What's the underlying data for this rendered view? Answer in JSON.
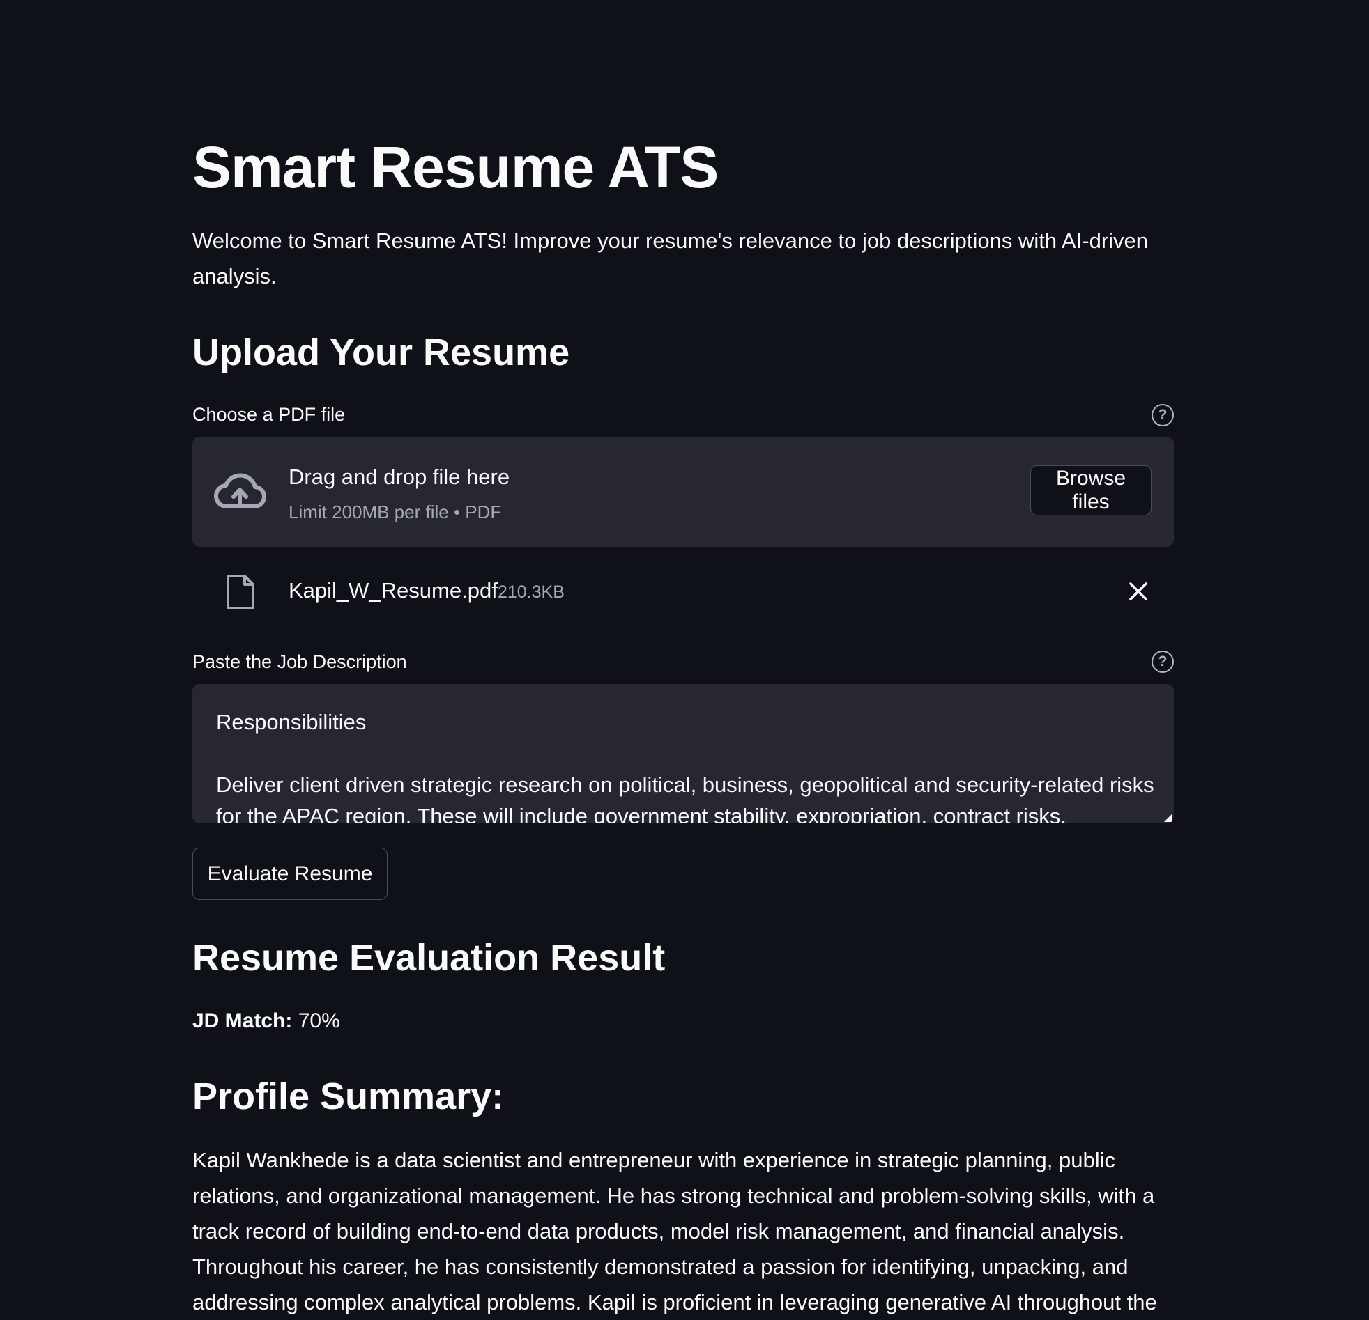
{
  "page": {
    "title": "Smart Resume ATS",
    "intro": "Welcome to Smart Resume ATS! Improve your resume's relevance to job descriptions with AI-driven analysis."
  },
  "upload": {
    "heading": "Upload Your Resume",
    "label": "Choose a PDF file",
    "help_icon": "question-circle-icon",
    "dropzone_icon": "cloud-upload-icon",
    "dropzone_title": "Drag and drop file here",
    "dropzone_subtitle": "Limit 200MB per file • PDF",
    "browse_label": "Browse files",
    "file": {
      "icon": "file-icon",
      "name": "Kapil_W_Resume.pdf",
      "size": "210.3KB",
      "remove_icon": "close-icon"
    }
  },
  "job": {
    "label": "Paste the Job Description",
    "help_icon": "question-circle-icon",
    "value": "Responsibilities\n\nDeliver client driven strategic research on political, business, geopolitical and security-related risks for the APAC region. These will include government stability, expropriation, contract risks,"
  },
  "actions": {
    "evaluate_label": "Evaluate Resume"
  },
  "result": {
    "heading": "Resume Evaluation Result",
    "match_label": "JD Match:",
    "match_value": "70%",
    "summary_heading": "Profile Summary:",
    "summary_text": "Kapil Wankhede is a data scientist and entrepreneur with experience in strategic planning, public relations, and organizational management. He has strong technical and problem-solving skills, with a track record of building end-to-end data products, model risk management, and financial analysis. Throughout his career, he has consistently demonstrated a passion for identifying, unpacking, and addressing complex analytical problems. Kapil is proficient in leveraging generative AI throughout the"
  },
  "colors": {
    "background": "#0e1117",
    "surface": "#262730",
    "text": "#fafafa",
    "muted": "#a3a8b4",
    "border": "#4a4d57"
  }
}
